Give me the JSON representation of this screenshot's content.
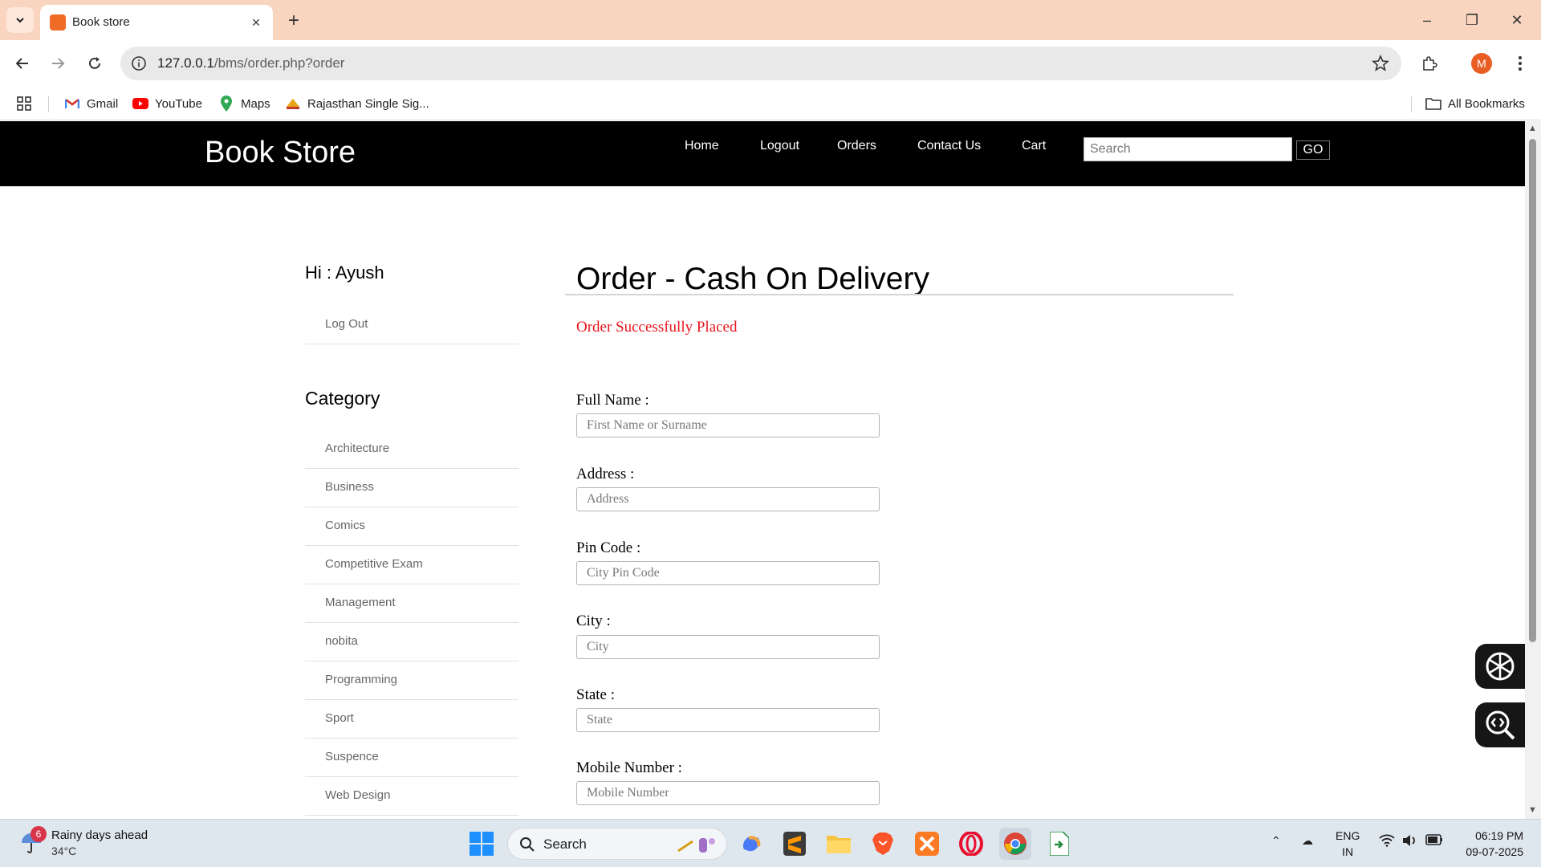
{
  "browser": {
    "tab_title": "Book store",
    "url_host": "127.0.0.1",
    "url_path": "/bms/order.php?order",
    "profile_initial": "M",
    "bookmarks": [
      {
        "label": "Gmail",
        "icon": "gmail-icon"
      },
      {
        "label": "YouTube",
        "icon": "youtube-icon"
      },
      {
        "label": "Maps",
        "icon": "maps-icon"
      },
      {
        "label": "Rajasthan Single Sig...",
        "icon": "rajasthan-icon"
      }
    ],
    "all_bookmarks_label": "All Bookmarks"
  },
  "site": {
    "brand": "Book Store",
    "nav": [
      "Home",
      "Logout",
      "Orders",
      "Contact Us",
      "Cart"
    ],
    "search_placeholder": "Search",
    "go_label": "GO"
  },
  "sidebar": {
    "greeting": "Hi : Ayush",
    "logout_label": "Log Out",
    "category_title": "Category",
    "categories": [
      "Architecture",
      "Business",
      "Comics",
      "Competitive Exam",
      "Management",
      "nobita",
      "Programming",
      "Sport",
      "Suspence",
      "Web Design"
    ]
  },
  "order": {
    "title": "Order - Cash On Delivery",
    "success_message": "Order Successfully Placed",
    "fields": [
      {
        "label": "Full Name :",
        "placeholder": "First Name or Surname"
      },
      {
        "label": "Address :",
        "placeholder": "Address"
      },
      {
        "label": "Pin Code :",
        "placeholder": "City Pin Code"
      },
      {
        "label": "City :",
        "placeholder": "City"
      },
      {
        "label": "State :",
        "placeholder": "State"
      },
      {
        "label": "Mobile Number :",
        "placeholder": "Mobile Number"
      }
    ]
  },
  "taskbar": {
    "weather_badge": "6",
    "weather_text": "Rainy days ahead",
    "temperature": "34°C",
    "search_label": "Search",
    "language": "ENG",
    "region": "IN",
    "time": "06:19 PM",
    "date": "09-07-2025"
  },
  "colors": {
    "header_bg": "#000000",
    "success_text": "#e8141a",
    "tabbar_bg": "#f9d5c0"
  }
}
